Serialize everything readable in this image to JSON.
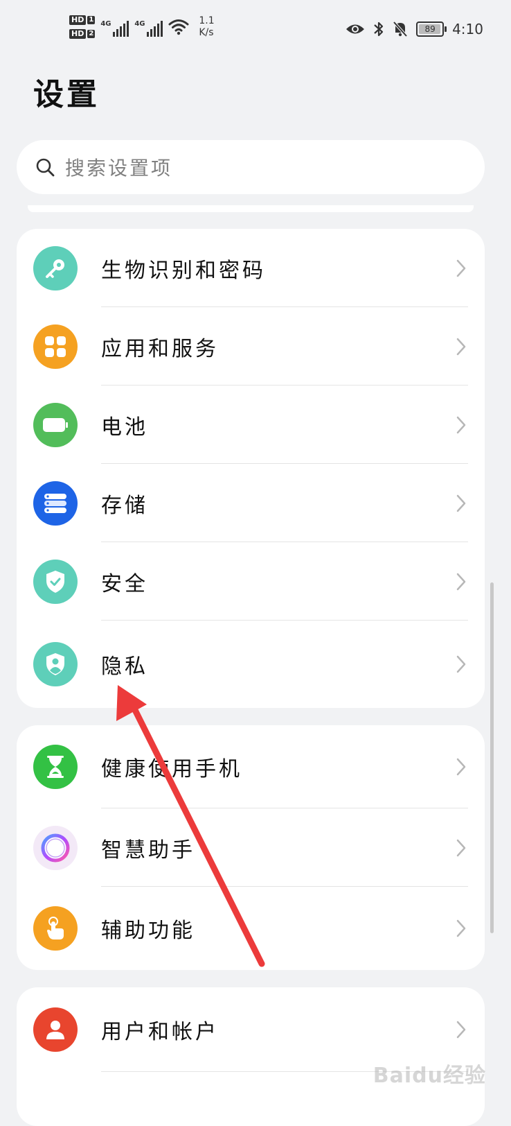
{
  "status_bar": {
    "hd1": "HD",
    "hd1_num": "1",
    "hd2": "HD",
    "hd2_num": "2",
    "sig1_tag": "4G",
    "sig2_tag": "4G",
    "speed_value": "1.1",
    "speed_unit": "K/s",
    "battery_level": "89",
    "time": "4:10",
    "icons": [
      "eye-icon",
      "bluetooth-icon",
      "bell-mute-icon",
      "battery-icon"
    ]
  },
  "page": {
    "title": "设置"
  },
  "search": {
    "placeholder": "搜索设置项"
  },
  "groups": [
    {
      "items": [
        {
          "label": "生物识别和密码",
          "icon": "key-icon",
          "color": "#5ecfb9"
        },
        {
          "label": "应用和服务",
          "icon": "apps-grid-icon",
          "color": "#f5a121"
        },
        {
          "label": "电池",
          "icon": "battery-icon",
          "color": "#52bd5a"
        },
        {
          "label": "存储",
          "icon": "storage-icon",
          "color": "#1e64e6"
        },
        {
          "label": "安全",
          "icon": "shield-check-icon",
          "color": "#5ecfb9"
        },
        {
          "label": "隐私",
          "icon": "privacy-shield-icon",
          "color": "#5ecfb9"
        }
      ]
    },
    {
      "items": [
        {
          "label": "健康使用手机",
          "icon": "hourglass-icon",
          "color": "#33c144"
        },
        {
          "label": "智慧助手",
          "icon": "assistant-ring-icon",
          "color": "#f3e9f7"
        },
        {
          "label": "辅助功能",
          "icon": "hand-tap-icon",
          "color": "#f5a121"
        }
      ]
    },
    {
      "items": [
        {
          "label": "用户和帐户",
          "icon": "user-icon",
          "color": "#e8452e"
        }
      ]
    }
  ],
  "watermark": "Baidu经验"
}
